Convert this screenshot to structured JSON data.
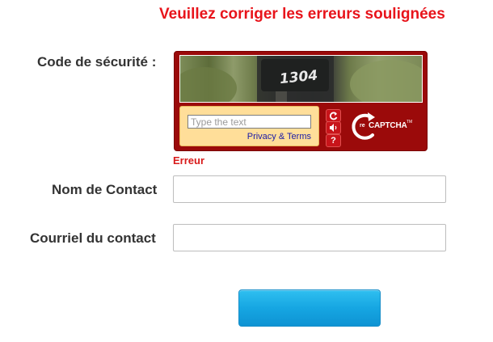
{
  "form": {
    "error_banner": "Veuillez corriger les erreurs soulignées",
    "captcha_label": "Code de sécurité :",
    "captcha_error": "Erreur",
    "contact_name_label": "Nom de Contact",
    "contact_name_value": "",
    "contact_email_label": "Courriel du contact",
    "contact_email_value": "",
    "submit_label": ""
  },
  "recaptcha": {
    "challenge_text": "1304",
    "input_placeholder": "Type the text",
    "privacy_label": "Privacy & Terms",
    "reload_icon": "reload-icon",
    "audio_icon": "audio-icon",
    "help_icon": "help-icon",
    "help_glyph": "?",
    "logo_prefix": "re",
    "logo_text": "CAPTCHA",
    "logo_tm": "TM"
  },
  "colors": {
    "error_red": "#e8141b",
    "recaptcha_bg": "#9b0a0a",
    "entry_panel": "#ffde99",
    "button_blue": "#16a6e2"
  }
}
